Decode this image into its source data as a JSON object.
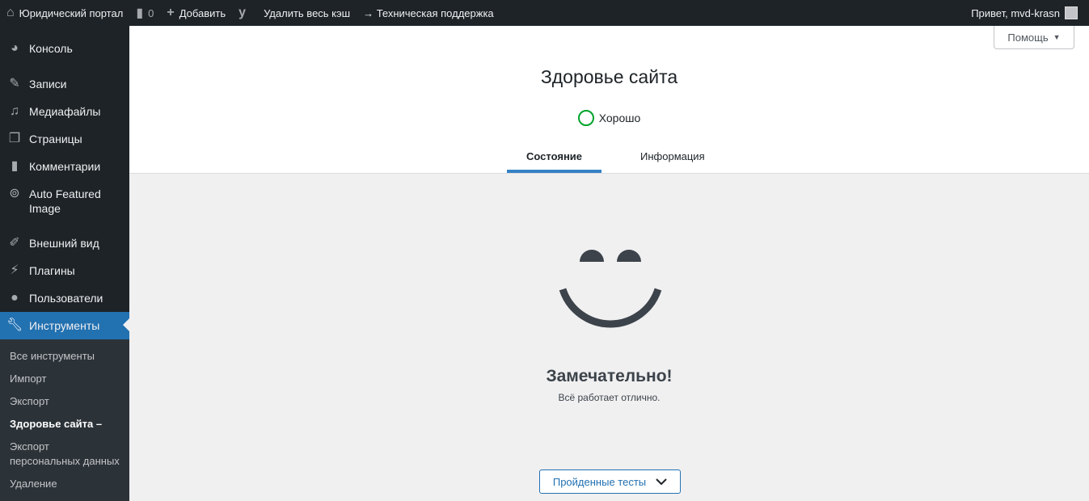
{
  "adminbar": {
    "site": "Юридический портал",
    "comments": "0",
    "add": "Добавить",
    "clear_cache": "Удалить весь кэш",
    "support": "→ Техническая поддержка",
    "greeting": "Привет, mvd-krasn"
  },
  "sidebar": {
    "items": [
      {
        "label": "Консоль",
        "icon": "dashboard-icon"
      },
      {
        "label": "Записи",
        "icon": "pin-icon"
      },
      {
        "label": "Медиафайлы",
        "icon": "media-icon"
      },
      {
        "label": "Страницы",
        "icon": "pages-icon"
      },
      {
        "label": "Комментарии",
        "icon": "comment-icon"
      },
      {
        "label": "Auto Featured Image",
        "icon": "image-search-icon"
      },
      {
        "label": "Внешний вид",
        "icon": "brush-icon"
      },
      {
        "label": "Плагины",
        "icon": "plugin-icon"
      },
      {
        "label": "Пользователи",
        "icon": "user-icon"
      },
      {
        "label": "Инструменты",
        "icon": "wrench-icon"
      }
    ],
    "submenu": [
      "Все инструменты",
      "Импорт",
      "Экспорт",
      "Здоровье сайта –",
      "Экспорт персональных данных",
      "Удаление"
    ]
  },
  "header": {
    "help": "Помощь",
    "title": "Здоровье сайта",
    "status": "Хорошо",
    "tabs": [
      "Состояние",
      "Информация"
    ]
  },
  "main": {
    "headline": "Замечательно!",
    "subtext": "Всё работает отлично.",
    "passed_button": "Пройденные тесты"
  },
  "colors": {
    "accent": "#2271b1",
    "good": "#00a32a"
  }
}
